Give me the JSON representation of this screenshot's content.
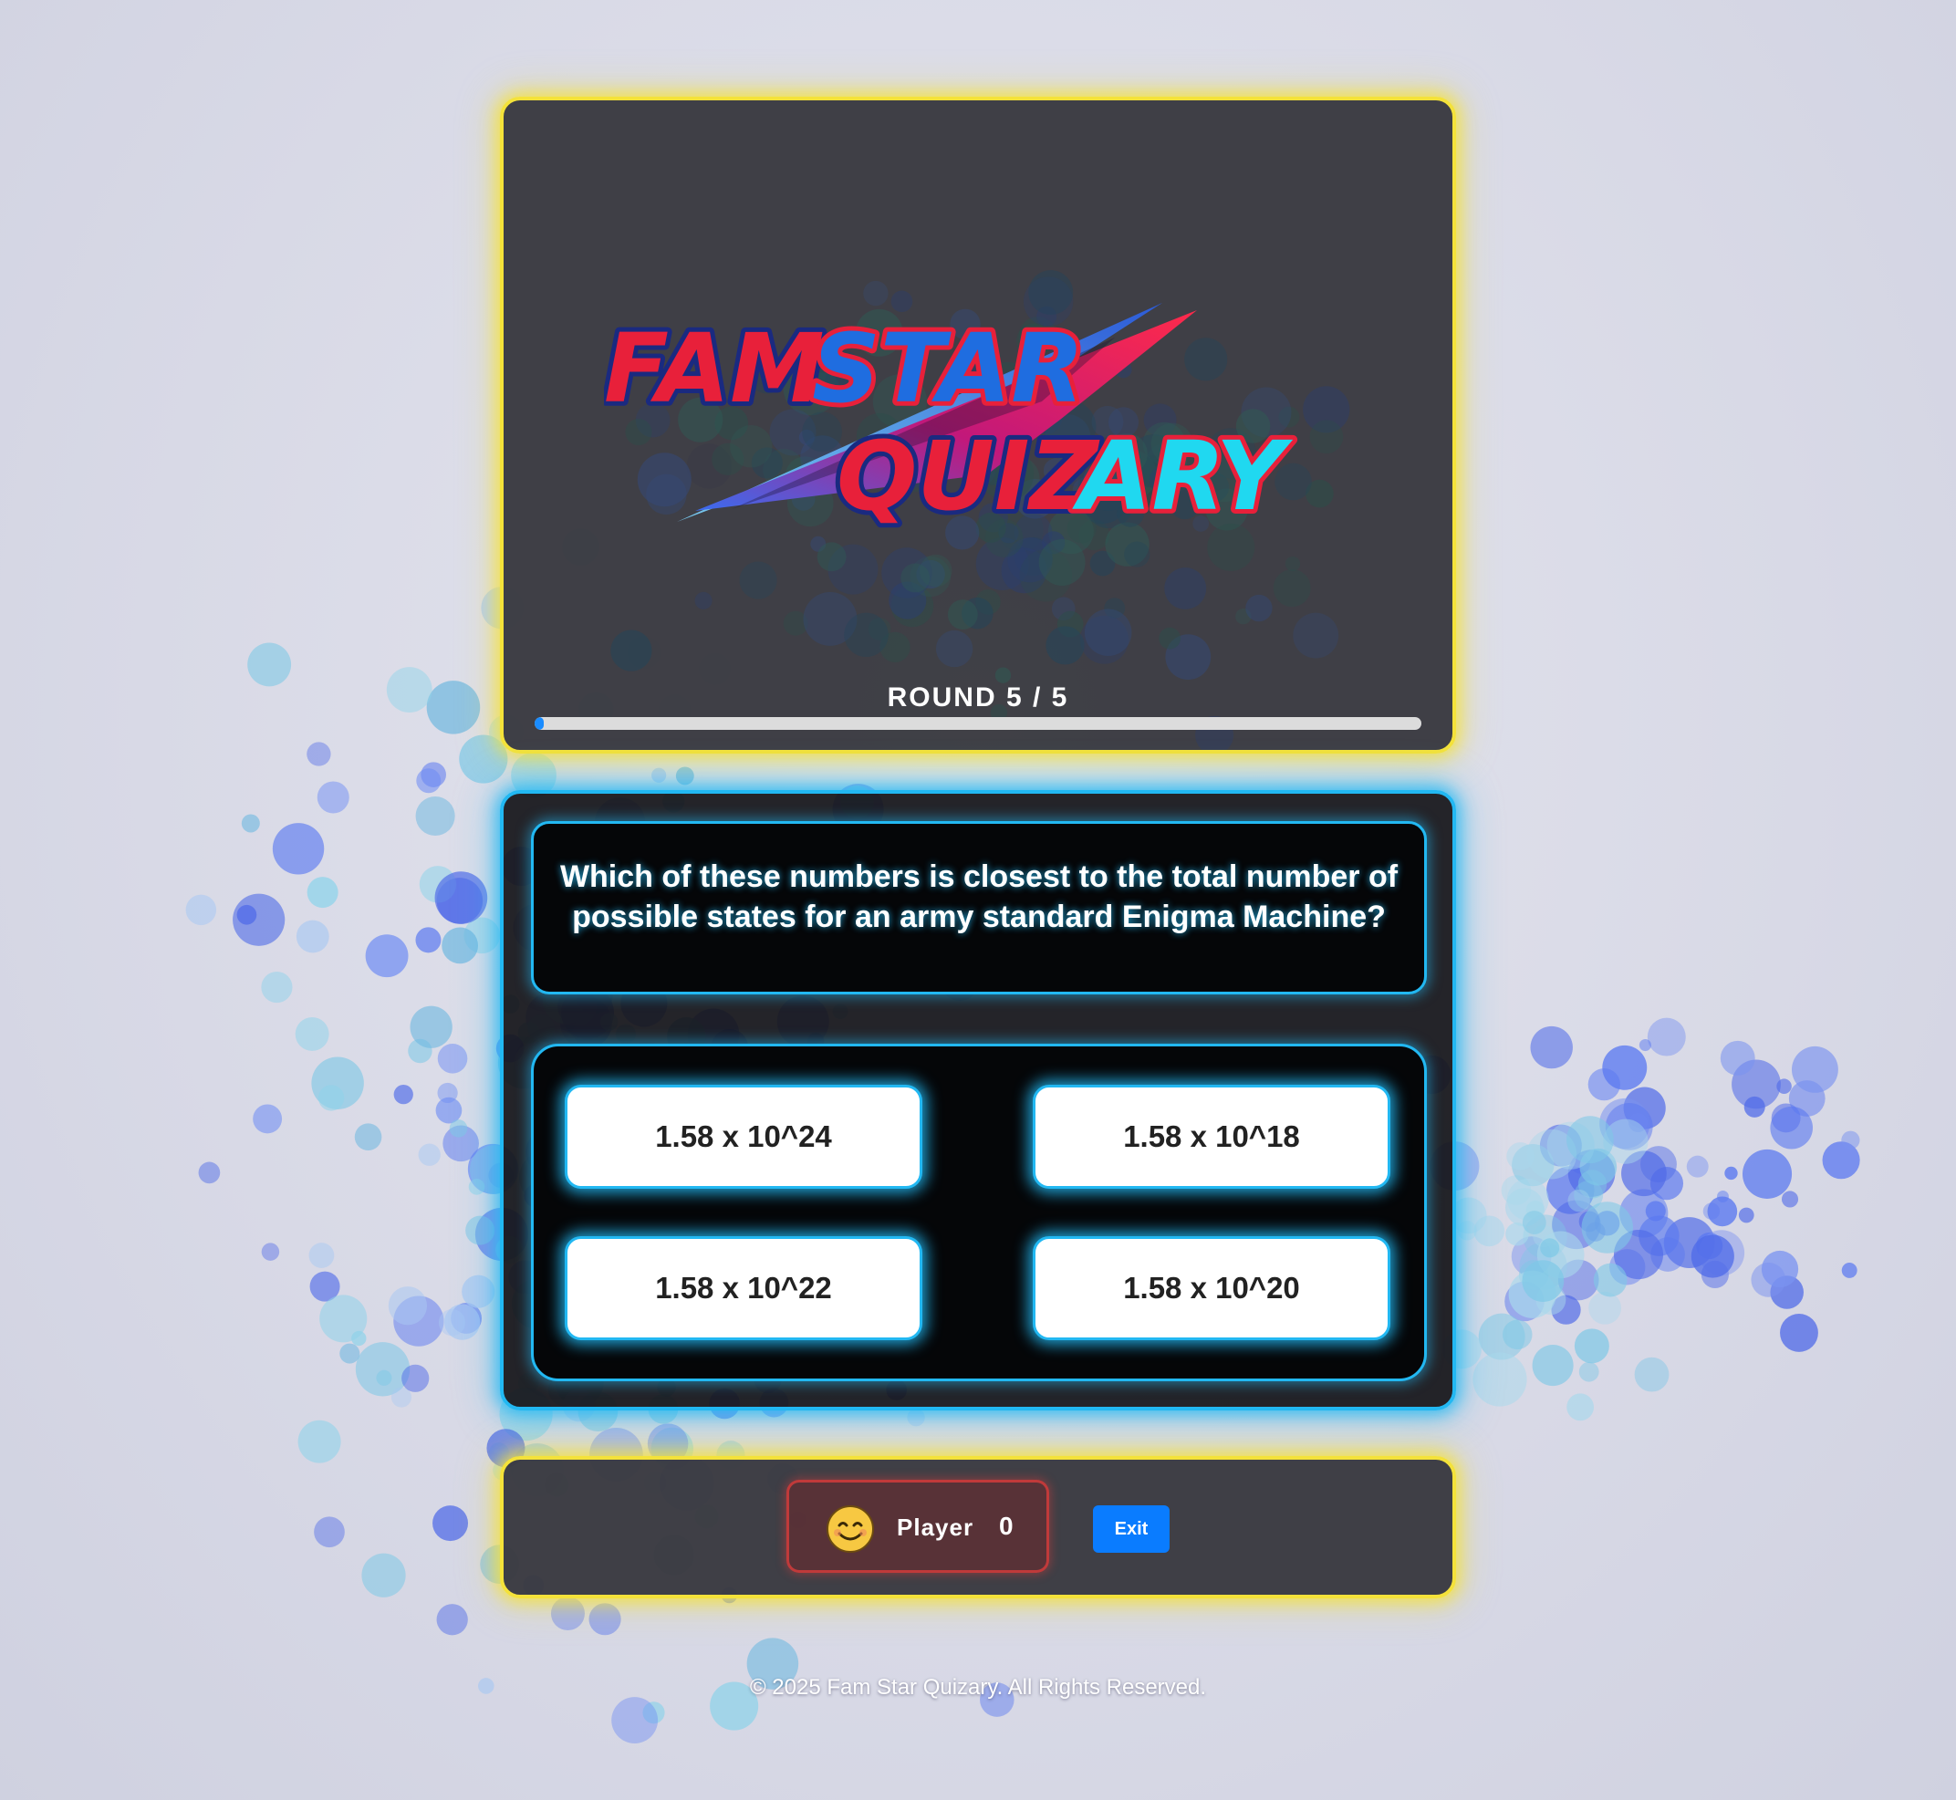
{
  "header": {
    "logo_line1_part1": "FAM",
    "logo_line1_part2": "STAR",
    "logo_line2_part1": "QUIZ",
    "logo_line2_part2": "ARY",
    "round_label": "ROUND 5 / 5",
    "progress_fraction": 0.01
  },
  "question": {
    "text": "Which of these numbers is closest to the total number of possible states for an army standard Enigma Machine?"
  },
  "answers": [
    {
      "label": "1.58 x 10^24"
    },
    {
      "label": "1.58 x 10^18"
    },
    {
      "label": "1.58 x 10^22"
    },
    {
      "label": "1.58 x 10^20"
    }
  ],
  "player": {
    "avatar_icon": "smiling-face-icon",
    "name": "Player",
    "score": "0"
  },
  "controls": {
    "exit_label": "Exit"
  },
  "footer": {
    "copyright": "© 2025 Fam Star Quizary. All Rights Reserved."
  },
  "colors": {
    "panel_glow_yellow": "#f4e23a",
    "panel_glow_blue": "#22b8f2",
    "exit_button": "#0a7cff",
    "player_border": "#d23c3c",
    "logo_red": "#e8203a",
    "logo_blue": "#1f6de0",
    "logo_cyan": "#20d8f0"
  }
}
